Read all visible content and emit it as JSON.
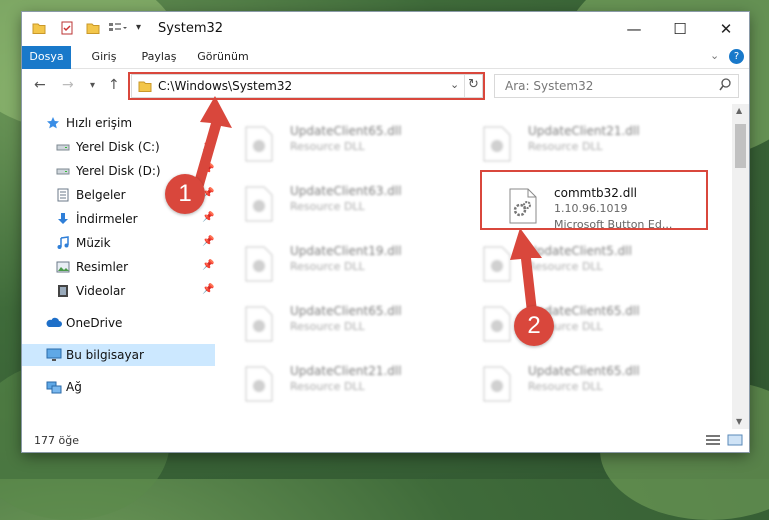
{
  "window": {
    "title": "System32",
    "controls": {
      "minimize": "—",
      "maximize": "☐",
      "close": "✕"
    }
  },
  "ribbon": {
    "tabs": [
      {
        "label": "Dosya",
        "active": true
      },
      {
        "label": "Giriş"
      },
      {
        "label": "Paylaş"
      },
      {
        "label": "Görünüm"
      }
    ],
    "expand_icon": "chevron-down-icon",
    "help_icon": "help-icon"
  },
  "navigation": {
    "back": "←",
    "forward": "→",
    "recent": "▾",
    "up": "↑",
    "address": "C:\\Windows\\System32",
    "refresh": "↻",
    "search_placeholder": "Ara: System32"
  },
  "sidebar": {
    "items": [
      {
        "label": "Hızlı erişim",
        "icon": "star-icon"
      },
      {
        "label": "Yerel Disk (C:)",
        "icon": "drive-icon",
        "pinned": true
      },
      {
        "label": "Yerel Disk (D:)",
        "icon": "drive-icon",
        "pinned": true
      },
      {
        "label": "Belgeler",
        "icon": "documents-icon",
        "pinned": true
      },
      {
        "label": "İndirmeler",
        "icon": "download-icon",
        "pinned": true
      },
      {
        "label": "Müzik",
        "icon": "music-icon",
        "pinned": true
      },
      {
        "label": "Resimler",
        "icon": "pictures-icon",
        "pinned": true
      },
      {
        "label": "Videolar",
        "icon": "video-icon",
        "pinned": true
      },
      {
        "label": "OneDrive",
        "icon": "cloud-icon"
      },
      {
        "label": "Bu bilgisayar",
        "icon": "computer-icon",
        "selected": true
      },
      {
        "label": "Ağ",
        "icon": "network-icon"
      }
    ]
  },
  "files": {
    "focused": {
      "name": "commtb32.dll",
      "version": "1.10.96.1019",
      "description": "Microsoft Button Ed..."
    },
    "blurred": [
      {
        "name": "UpdateClient65.dll",
        "type": "Resource DLL"
      },
      {
        "name": "UpdateClient21.dll",
        "type": "Resource DLL"
      },
      {
        "name": "UpdateClient63.dll",
        "type": "Resource DLL"
      },
      {
        "name": "UpdateClient19.dll",
        "type": "Resource DLL"
      },
      {
        "name": "UpdateClient5.dll",
        "type": "Resource DLL"
      },
      {
        "name": "UpdateClient65.dll",
        "type": "Resource DLL"
      },
      {
        "name": "UpdateClient65.dll",
        "type": "Resource DLL"
      },
      {
        "name": "UpdateClient21.dll",
        "type": "Resource DLL"
      },
      {
        "name": "UpdateClient65.dll",
        "type": "Resource DLL"
      }
    ]
  },
  "status": {
    "count": "177 öğe"
  },
  "annotations": {
    "badge_1": "1",
    "badge_2": "2",
    "accent_color": "#d9473c"
  }
}
